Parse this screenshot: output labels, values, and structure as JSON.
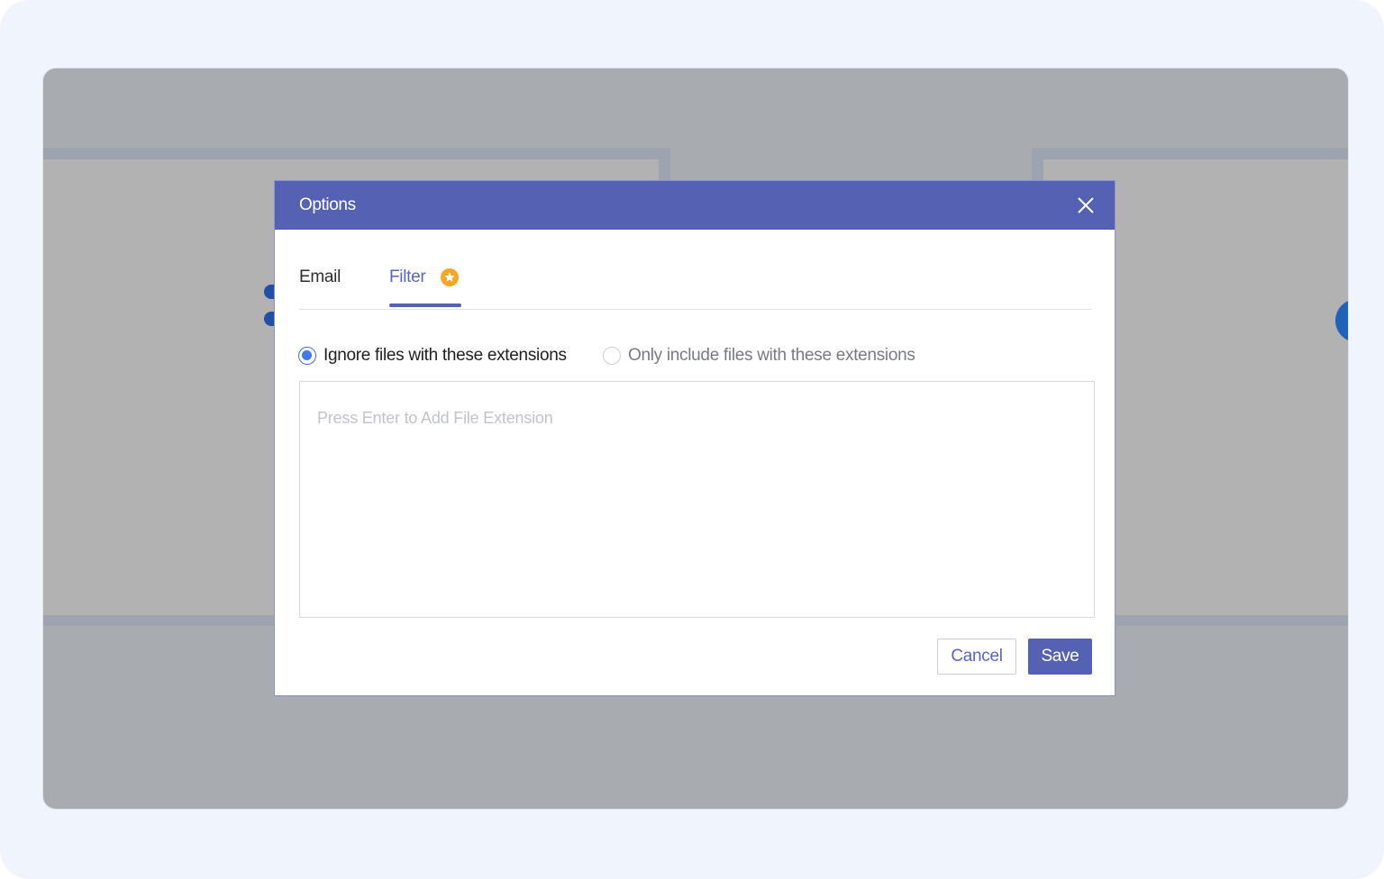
{
  "dialog": {
    "title": "Options",
    "close_icon": "close-icon"
  },
  "tabs": [
    {
      "label": "Email",
      "active": false
    },
    {
      "label": "Filter",
      "active": true,
      "badge_icon": "star-badge-icon",
      "badge_color": "#f5a623"
    }
  ],
  "filter": {
    "mode_options": [
      {
        "label": "Ignore files with these extensions",
        "checked": true
      },
      {
        "label": "Only include files with these extensions",
        "checked": false
      }
    ],
    "extension_input": {
      "value": "",
      "placeholder": "Press Enter to Add File Extension"
    }
  },
  "actions": {
    "cancel_label": "Cancel",
    "save_label": "Save"
  },
  "colors": {
    "header": "#5561b3",
    "accent": "#5866c0",
    "radio_checked": "#3f78f0",
    "overlay": "#a8abb0"
  }
}
